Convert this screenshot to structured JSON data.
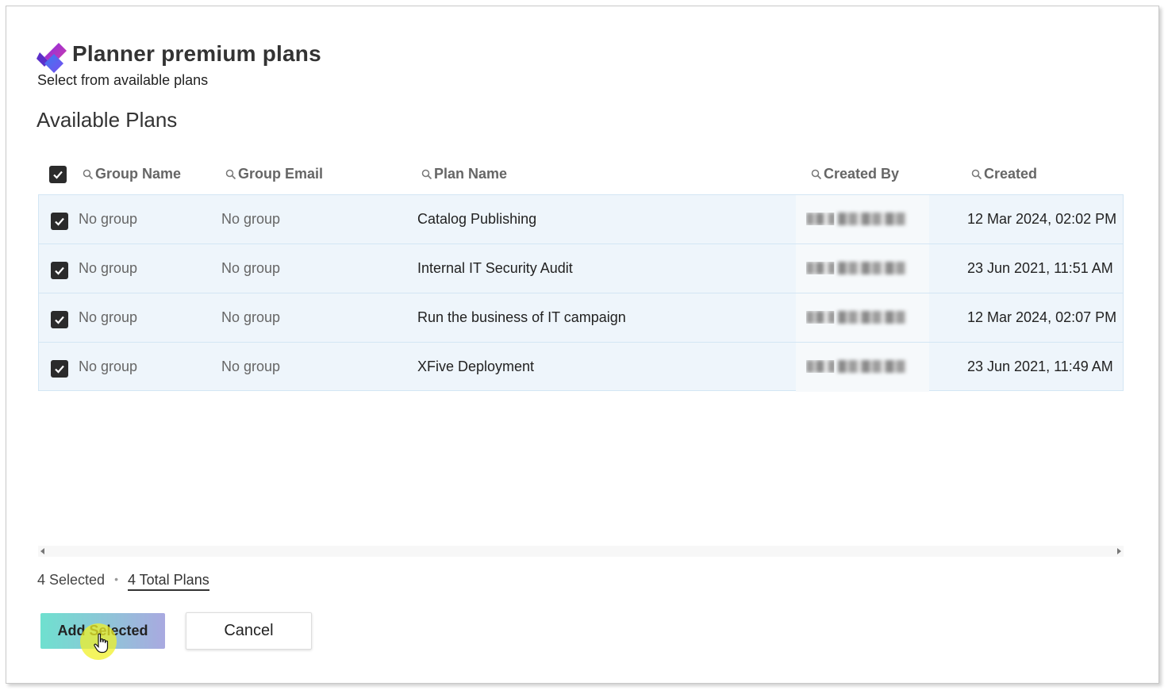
{
  "header": {
    "title": "Planner premium plans",
    "subtitle": "Select from available plans",
    "logo_icon": "planner-logo-icon"
  },
  "section_title": "Available Plans",
  "table": {
    "header_checkbox_checked": true,
    "columns": [
      "Group Name",
      "Group Email",
      "Plan Name",
      "Created By",
      "Created"
    ],
    "rows": [
      {
        "checked": true,
        "group_name": "No group",
        "group_email": "No group",
        "plan_name": "Catalog Publishing",
        "created_by": "",
        "created": "12 Mar 2024, 02:02 PM"
      },
      {
        "checked": true,
        "group_name": "No group",
        "group_email": "No group",
        "plan_name": "Internal IT Security Audit",
        "created_by": "",
        "created": "23 Jun 2021, 11:51 AM"
      },
      {
        "checked": true,
        "group_name": "No group",
        "group_email": "No group",
        "plan_name": "Run the business of IT campaign",
        "created_by": "",
        "created": "12 Mar 2024, 02:07 PM"
      },
      {
        "checked": true,
        "group_name": "No group",
        "group_email": "No group",
        "plan_name": "XFive Deployment",
        "created_by": "",
        "created": "23 Jun 2021, 11:49 AM"
      }
    ]
  },
  "footer": {
    "selected": "4 Selected",
    "separator": "•",
    "total": "4 Total Plans"
  },
  "buttons": {
    "add_selected": "Add Selected",
    "cancel": "Cancel"
  },
  "colors": {
    "row_background": "#eef5fb",
    "checkbox": "#2b2b2b",
    "add_button_gradient_start": "#6fe0cf",
    "add_button_gradient_end": "#a9a9e0"
  }
}
